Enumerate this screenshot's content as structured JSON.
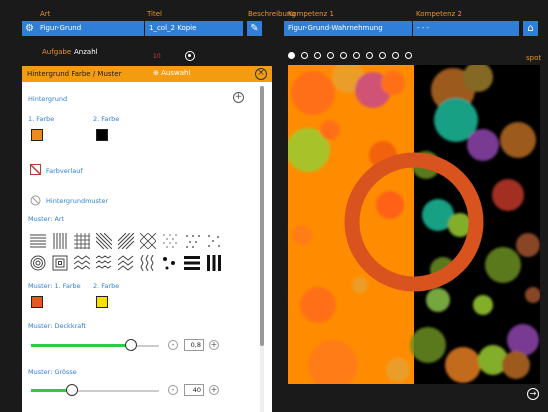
{
  "topbar": {
    "fields": [
      {
        "label": "Art",
        "value": "Figur-Grund"
      },
      {
        "label": "Titel",
        "value": "1_col_2 Kopie"
      },
      {
        "label": "Beschreibung",
        "value": ""
      },
      {
        "label": "Kompetenz 1",
        "value": "Figur-Grund-Wahrnehmung"
      },
      {
        "label": "Kompetenz 2",
        "value": "- - -"
      }
    ],
    "accent": "#2f7fd8",
    "label_color": "#e8912a"
  },
  "tabs": {
    "items": [
      "Aufgabe",
      "Anzahl"
    ],
    "active": "Anzahl",
    "badge": "10"
  },
  "panel": {
    "title": "Hintergrund Farbe / Muster",
    "add_label": "Auswahl",
    "section_hintergrund": "Hintergrund",
    "color1_label": "1. Farbe",
    "color2_label": "2. Farbe",
    "color1": "#f08a1c",
    "color2": "#000000",
    "gradient_label": "Farbverlauf",
    "pattern_label": "Hintergrundmuster",
    "pattern_type_label": "Muster: Art",
    "pattern_color1_label": "Muster: 1. Farbe",
    "pattern_color2_label": "2. Farbe",
    "pattern_color1": "#e05a1e",
    "pattern_color2": "#f5e000",
    "opacity_label": "Muster: Deckkraft",
    "opacity_value": "0,8",
    "opacity_fraction": 0.8,
    "size_label": "Muster: Grösse",
    "size_value": "40",
    "size_fraction": 0.3
  },
  "carousel": {
    "count": 10,
    "active_index": 0,
    "spot_label": "spot"
  },
  "preview": {
    "left_color": "#ff8c00",
    "right_color": "#000000",
    "ring_color": "#d9531e"
  }
}
